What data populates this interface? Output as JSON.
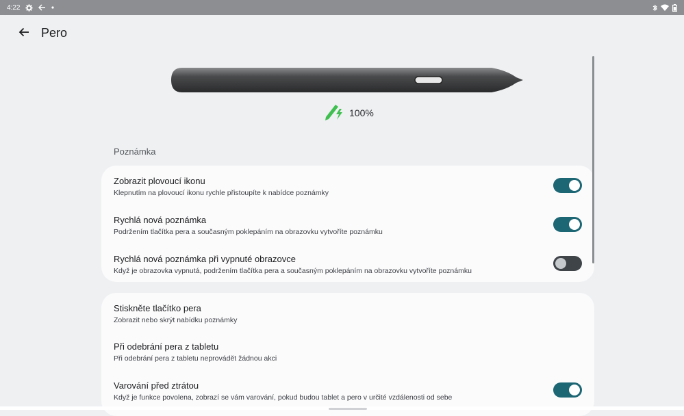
{
  "status_bar": {
    "time": "4:22",
    "icons": [
      "gear-icon",
      "back-arrow-icon",
      "dot-icon",
      "bluetooth-icon",
      "wifi-icon",
      "battery-icon"
    ]
  },
  "app_bar": {
    "back_icon": "arrow-back-icon",
    "title": "Pero"
  },
  "pen": {
    "image": "stylus-pen-illustration",
    "battery_icon": "pen-charging-icon",
    "battery_text": "100%"
  },
  "section": {
    "title": "Poznámka"
  },
  "card1": {
    "items": [
      {
        "title": "Zobrazit plovoucí ikonu",
        "subtitle": "Klepnutím na plovoucí ikonu rychle přistoupíte k nabídce poznámky",
        "toggle": true
      },
      {
        "title": "Rychlá nová poznámka",
        "subtitle": "Podržením tlačítka pera a současným poklepáním na obrazovku vytvoříte poznámku",
        "toggle": true
      },
      {
        "title": "Rychlá nová poznámka při vypnuté obrazovce",
        "subtitle": "Když je obrazovka vypnutá, podržením tlačítka pera a současným poklepáním na obrazovku vytvoříte poznámku",
        "toggle": false
      }
    ]
  },
  "card2": {
    "items": [
      {
        "title": "Stiskněte tlačítko pera",
        "subtitle": "Zobrazit nebo skrýt nabídku poznámky"
      },
      {
        "title": "Při odebrání pera z tabletu",
        "subtitle": "Při odebrání pera z tabletu neprovádět žádnou akci"
      },
      {
        "title": "Varování před ztrátou",
        "subtitle": "Když je funkce povolena, zobrazí se vám varování, pokud budou tablet a pero v určité vzdálenosti od sebe",
        "toggle": true
      }
    ]
  },
  "colors": {
    "toggle_on": "#1d6674",
    "toggle_off": "#3f4449",
    "background": "#eef0f2",
    "card": "#fbfbfc",
    "battery_green": "#3fbf4f"
  }
}
